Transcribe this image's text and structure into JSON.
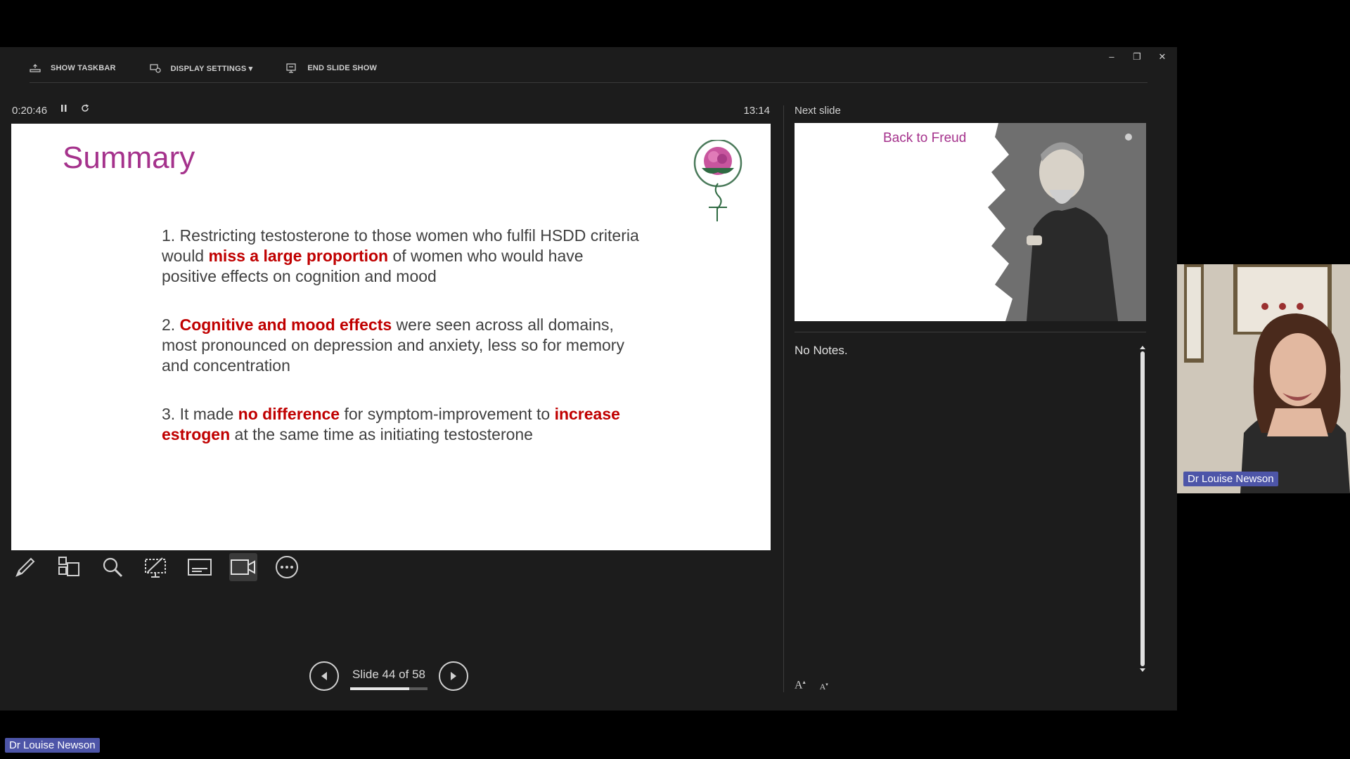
{
  "toolbar": {
    "show_taskbar": "SHOW TASKBAR",
    "display_settings": "DISPLAY SETTINGS ▾",
    "end_slide_show": "END SLIDE SHOW"
  },
  "window_controls": {
    "minimize": "–",
    "restore": "❐",
    "close": "✕"
  },
  "timer": {
    "elapsed": "0:20:46",
    "pause_icon": "pause-icon",
    "reset_icon": "reset-icon",
    "clock": "13:14"
  },
  "slide": {
    "title": "Summary",
    "points": [
      {
        "parts": [
          {
            "text": "1. Restricting testosterone to those women who fulfil HSDD criteria would ",
            "hl": false
          },
          {
            "text": "miss a large proportion",
            "hl": true
          },
          {
            "text": " of women who would have positive effects on cognition and mood",
            "hl": false
          }
        ]
      },
      {
        "parts": [
          {
            "text": "2. ",
            "hl": false
          },
          {
            "text": "Cognitive and mood effects",
            "hl": true
          },
          {
            "text": " were seen across all domains, most pronounced on depression and anxiety, less so for memory and concentration",
            "hl": false
          }
        ]
      },
      {
        "parts": [
          {
            "text": "3. It made ",
            "hl": false
          },
          {
            "text": "no difference",
            "hl": true
          },
          {
            "text": " for symptom-improvement to ",
            "hl": false
          },
          {
            "text": "increase estrogen",
            "hl": true
          },
          {
            "text": " at the same time as initiating testosterone",
            "hl": false
          }
        ]
      }
    ],
    "colors": {
      "title": "#a5328c",
      "highlight": "#c00000",
      "body": "#404040"
    }
  },
  "tools": [
    "pen-icon",
    "see-all-slides-icon",
    "zoom-icon",
    "pointer-icon",
    "subtitles-icon",
    "camera-icon",
    "more-options-icon"
  ],
  "navigation": {
    "counter": "Slide 44 of 58",
    "current": 44,
    "total": 58,
    "progress": 0.76
  },
  "next_slide": {
    "label": "Next slide",
    "title": "Back to Freud"
  },
  "notes": {
    "text": "No Notes."
  },
  "font_buttons": {
    "increase": "A",
    "decrease": "A"
  },
  "webcam": {
    "name": "Dr Louise Newson"
  },
  "participant_label": "Dr Louise Newson"
}
